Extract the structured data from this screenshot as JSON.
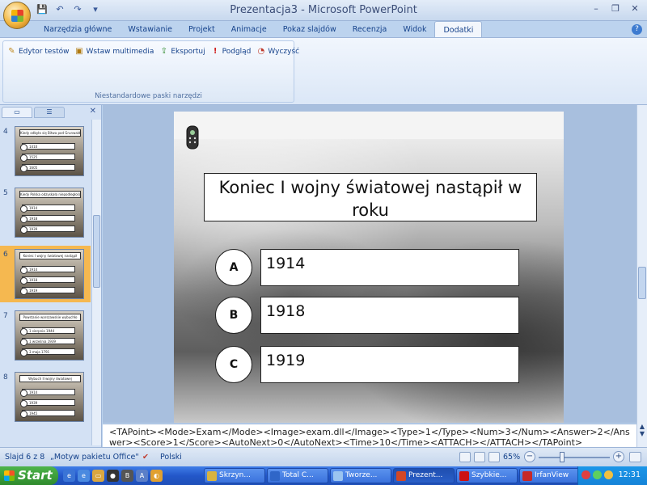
{
  "window": {
    "title": "Prezentacja3 - Microsoft PowerPoint",
    "minimize": "–",
    "restore": "❐",
    "close": "✕"
  },
  "qat": {
    "save_icon": "save-icon",
    "undo_icon": "undo-icon",
    "redo_icon": "redo-icon",
    "customize": "▾"
  },
  "ribbon": {
    "tabs": [
      "Narzędzia główne",
      "Wstawianie",
      "Projekt",
      "Animacje",
      "Pokaz slajdów",
      "Recenzja",
      "Widok",
      "Dodatki"
    ],
    "active_tab": "Dodatki",
    "help": "?",
    "group_label": "Niestandardowe paski narzędzi",
    "tools": [
      {
        "label": "Edytor testów",
        "icon": "editor-icon"
      },
      {
        "label": "Wstaw multimedia",
        "icon": "media-icon"
      },
      {
        "label": "Eksportuj",
        "icon": "export-icon"
      },
      {
        "label": "Podgląd",
        "icon": "exclamation-icon"
      },
      {
        "label": "Wyczyść",
        "icon": "clear-icon"
      }
    ]
  },
  "slides_pane": {
    "close": "✕",
    "thumbnails": [
      {
        "num": "4",
        "title": "Kiedy odbyła się Bitwa pod Grunwaldem",
        "answers": [
          "1410",
          "1525",
          "1605"
        ],
        "selected": false
      },
      {
        "num": "5",
        "title": "Kiedy Polska odzyskała niepodległość",
        "answers": [
          "1914",
          "1918",
          "1939"
        ],
        "selected": false
      },
      {
        "num": "6",
        "title": "Koniec I wojny światowej nastąpił",
        "answers": [
          "1914",
          "1918",
          "1919"
        ],
        "selected": true
      },
      {
        "num": "7",
        "title": "Powstanie warszawskie wybuchło",
        "answers": [
          "1 sierpnia 1944",
          "1 września 1939",
          "3 maja 1791"
        ],
        "selected": false
      },
      {
        "num": "8",
        "title": "Wybuch II wojny światowej",
        "answers": [
          "1914",
          "1939",
          "1945"
        ],
        "selected": false
      }
    ]
  },
  "slide": {
    "question": "Koniec I wojny światowej nastąpił w roku",
    "answers": [
      {
        "letter": "A",
        "value": "1914"
      },
      {
        "letter": "B",
        "value": "1918"
      },
      {
        "letter": "C",
        "value": "1919"
      }
    ]
  },
  "notes": "<TAPoint><Mode>Exam</Mode><Image>exam.dll</Image><Type>1</Type><Num>3</Num><Answer>2</Answer><Score>1</Score><AutoNext>0</AutoNext><Time>10</Time><ATTACH></ATTACH></TAPoint>",
  "status": {
    "slide": "Slajd 6 z 8",
    "theme": "„Motyw pakietu Office\"",
    "language": "Polski",
    "zoom": "65%",
    "zoom_fraction": 0.33
  },
  "taskbar": {
    "start": "Start",
    "tasks": [
      {
        "label": "Skrzyn...",
        "active": false,
        "color": "#d8b340"
      },
      {
        "label": "Total C...",
        "active": false,
        "color": "#2f66c8"
      },
      {
        "label": "Tworze...",
        "active": false,
        "color": "#9ac4f0"
      },
      {
        "label": "Prezent...",
        "active": true,
        "color": "#d24726"
      },
      {
        "label": "Szybkie...",
        "active": false,
        "color": "#cc1111"
      },
      {
        "label": "IrfanView",
        "active": false,
        "color": "#c62828"
      }
    ],
    "clock": "12:31"
  }
}
